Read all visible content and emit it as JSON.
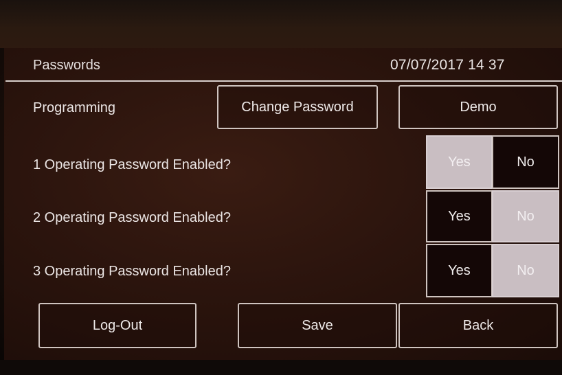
{
  "screen": {
    "title": "Passwords",
    "datetime": "07/07/2017 14 37"
  },
  "programming": {
    "label": "Programming",
    "change_password_label": "Change Password",
    "demo_label": "Demo"
  },
  "options": [
    {
      "label": "1 Operating Password Enabled?",
      "yes": "Yes",
      "no": "No",
      "selected": "Yes"
    },
    {
      "label": "2 Operating Password Enabled?",
      "yes": "Yes",
      "no": "No",
      "selected": "No"
    },
    {
      "label": "3 Operating Password Enabled?",
      "yes": "Yes",
      "no": "No",
      "selected": "No"
    }
  ],
  "footer": {
    "logout_label": "Log-Out",
    "save_label": "Save",
    "back_label": "Back"
  },
  "colors": {
    "selected_segment": "#c9bec2",
    "unselected_segment": "#140706",
    "text": "#ebe5e4"
  }
}
